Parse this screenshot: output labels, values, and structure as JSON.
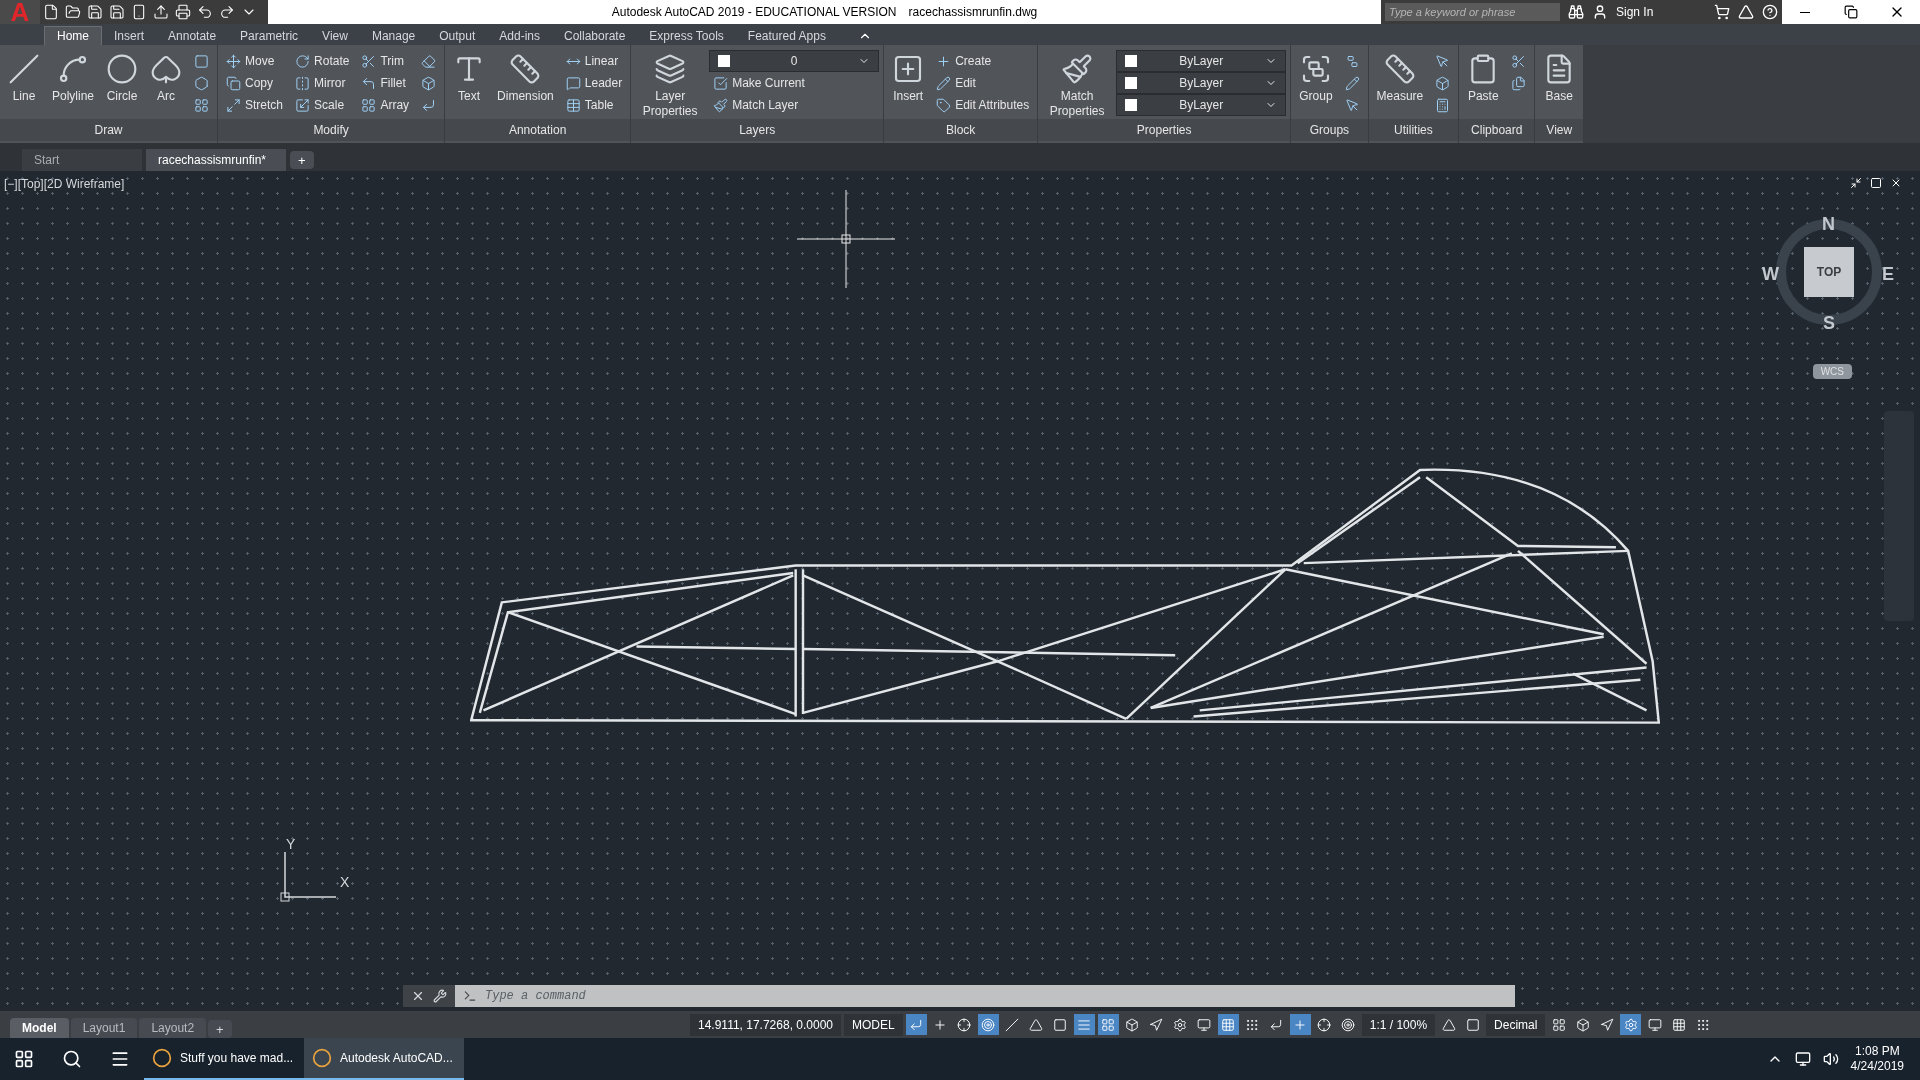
{
  "app_button": {
    "label": "A"
  },
  "window": {
    "title": "Autodesk AutoCAD 2019 - EDUCATIONAL VERSION",
    "file": "racechassismrunfin.dwg"
  },
  "search": {
    "placeholder": "Type a keyword or phrase"
  },
  "sign_in": "Sign In",
  "ribbon_tabs": [
    {
      "label": "Home",
      "selected": true
    },
    {
      "label": "Insert",
      "selected": false
    },
    {
      "label": "Annotate",
      "selected": false
    },
    {
      "label": "Parametric",
      "selected": false
    },
    {
      "label": "View",
      "selected": false
    },
    {
      "label": "Manage",
      "selected": false
    },
    {
      "label": "Output",
      "selected": false
    },
    {
      "label": "Add-ins",
      "selected": false
    },
    {
      "label": "Collaborate",
      "selected": false
    },
    {
      "label": "Express Tools",
      "selected": false
    },
    {
      "label": "Featured Apps",
      "selected": false
    }
  ],
  "panels": [
    {
      "title": "Draw",
      "tools": [
        {
          "kind": "large",
          "label": "Line"
        },
        {
          "kind": "large",
          "label": "Polyline"
        },
        {
          "kind": "large",
          "label": "Circle"
        },
        {
          "kind": "large",
          "label": "Arc"
        },
        {
          "kind": "icon"
        },
        {
          "kind": "icon"
        },
        {
          "kind": "icon"
        }
      ]
    },
    {
      "title": "Modify",
      "tools": [
        {
          "kind": "small",
          "label": "Move"
        },
        {
          "kind": "small",
          "label": "Copy"
        },
        {
          "kind": "small",
          "label": "Stretch"
        },
        {
          "kind": "small",
          "label": "Rotate"
        },
        {
          "kind": "small",
          "label": "Mirror"
        },
        {
          "kind": "small",
          "label": "Scale"
        },
        {
          "kind": "small",
          "label": "Trim"
        },
        {
          "kind": "small",
          "label": "Fillet"
        },
        {
          "kind": "small",
          "label": "Array"
        },
        {
          "kind": "icon"
        },
        {
          "kind": "icon"
        },
        {
          "kind": "icon"
        }
      ]
    },
    {
      "title": "Annotation",
      "tools": [
        {
          "kind": "large",
          "label": "Text"
        },
        {
          "kind": "large",
          "label": "Dimension"
        },
        {
          "kind": "small",
          "label": "Linear"
        },
        {
          "kind": "small",
          "label": "Leader"
        },
        {
          "kind": "small",
          "label": "Table"
        }
      ]
    },
    {
      "title": "Layers",
      "tools": [
        {
          "kind": "large",
          "label": "Layer Properties"
        },
        {
          "kind": "dropdown",
          "label": "0"
        },
        {
          "kind": "small",
          "label": "Make Current"
        },
        {
          "kind": "small",
          "label": "Match Layer"
        }
      ]
    },
    {
      "title": "Block",
      "tools": [
        {
          "kind": "large",
          "label": "Insert"
        },
        {
          "kind": "small",
          "label": "Create"
        },
        {
          "kind": "small",
          "label": "Edit"
        },
        {
          "kind": "small",
          "label": "Edit Attributes"
        }
      ]
    },
    {
      "title": "Properties",
      "tools": [
        {
          "kind": "large",
          "label": "Match Properties"
        },
        {
          "kind": "dropdown",
          "label": "ByLayer"
        },
        {
          "kind": "dropdown",
          "label": "ByLayer"
        },
        {
          "kind": "dropdown",
          "label": "ByLayer"
        }
      ]
    },
    {
      "title": "Groups",
      "tools": [
        {
          "kind": "large",
          "label": "Group"
        },
        {
          "kind": "icon"
        },
        {
          "kind": "icon"
        },
        {
          "kind": "icon"
        }
      ]
    },
    {
      "title": "Utilities",
      "tools": [
        {
          "kind": "large",
          "label": "Measure"
        },
        {
          "kind": "icon"
        },
        {
          "kind": "icon"
        },
        {
          "kind": "icon"
        }
      ]
    },
    {
      "title": "Clipboard",
      "tools": [
        {
          "kind": "large",
          "label": "Paste"
        },
        {
          "kind": "icon"
        },
        {
          "kind": "icon"
        }
      ]
    },
    {
      "title": "View",
      "tools": [
        {
          "kind": "large",
          "label": "Base"
        }
      ]
    }
  ],
  "doc_tabs": [
    {
      "label": "Start",
      "selected": false
    },
    {
      "label": "racechassismrunfin*",
      "selected": true
    }
  ],
  "new_tab": "+",
  "viewport_label": "[−][Top][2D Wireframe]",
  "viewcube": {
    "n": "N",
    "e": "E",
    "s": "S",
    "w": "W",
    "face": "TOP",
    "ucs": "WCS"
  },
  "ucs": {
    "x": "X",
    "y": "Y"
  },
  "command": {
    "placeholder": "Type a command"
  },
  "layout_tabs": [
    {
      "label": "Model",
      "selected": true
    },
    {
      "label": "Layout1",
      "selected": false
    },
    {
      "label": "Layout2",
      "selected": false
    }
  ],
  "new_layout": "+",
  "status_items": [
    {
      "kind": "readout",
      "label": "14.9111, 17.7268, 0.0000"
    },
    {
      "kind": "readout",
      "label": "MODEL"
    },
    {
      "kind": "toggle",
      "on": true
    },
    {
      "kind": "toggle",
      "on": false
    },
    {
      "kind": "toggle",
      "on": false
    },
    {
      "kind": "toggle",
      "on": true
    },
    {
      "kind": "toggle",
      "on": false
    },
    {
      "kind": "toggle",
      "on": false
    },
    {
      "kind": "toggle",
      "on": false
    },
    {
      "kind": "toggle",
      "on": true
    },
    {
      "kind": "toggle",
      "on": true
    },
    {
      "kind": "toggle",
      "on": false
    },
    {
      "kind": "toggle",
      "on": false
    },
    {
      "kind": "toggle",
      "on": false
    },
    {
      "kind": "toggle",
      "on": false
    },
    {
      "kind": "toggle",
      "on": true
    },
    {
      "kind": "toggle",
      "on": false
    },
    {
      "kind": "toggle",
      "on": false
    },
    {
      "kind": "toggle",
      "on": true
    },
    {
      "kind": "toggle",
      "on": false
    },
    {
      "kind": "toggle",
      "on": false
    },
    {
      "kind": "readout",
      "label": "1:1 / 100%"
    },
    {
      "kind": "toggle",
      "on": false
    },
    {
      "kind": "toggle",
      "on": false
    },
    {
      "kind": "readout",
      "label": "Decimal"
    },
    {
      "kind": "toggle",
      "on": false
    },
    {
      "kind": "toggle",
      "on": false
    },
    {
      "kind": "toggle",
      "on": false
    },
    {
      "kind": "toggle",
      "on": true
    },
    {
      "kind": "toggle",
      "on": false
    },
    {
      "kind": "toggle",
      "on": false
    },
    {
      "kind": "toggle",
      "on": false
    }
  ],
  "taskbar": [
    {
      "label": "Stuff you have mad...",
      "selected": false
    },
    {
      "label": "Autodesk AutoCAD...",
      "selected": true
    }
  ],
  "clock": {
    "time": "1:08 PM",
    "date": "4/24/2019"
  }
}
